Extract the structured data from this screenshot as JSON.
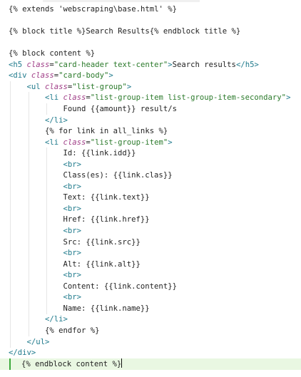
{
  "editor": {
    "lines": [
      {
        "indent": 0,
        "parts": [
          {
            "t": "plain",
            "v": "{% extends 'webscraping\\base.html' %}"
          }
        ]
      },
      {
        "indent": 0,
        "parts": []
      },
      {
        "indent": 0,
        "parts": [
          {
            "t": "plain",
            "v": "{% block title %}Search Results{% endblock title %}"
          }
        ]
      },
      {
        "indent": 0,
        "parts": []
      },
      {
        "indent": 0,
        "parts": [
          {
            "t": "plain",
            "v": "{% block content %}"
          }
        ]
      },
      {
        "indent": 0,
        "parts": [
          {
            "t": "tag",
            "v": "<h5 "
          },
          {
            "t": "attr",
            "v": "class"
          },
          {
            "t": "plain",
            "v": "="
          },
          {
            "t": "str",
            "v": "\"card-header text-center\""
          },
          {
            "t": "tag",
            "v": ">"
          },
          {
            "t": "plain",
            "v": "Search results"
          },
          {
            "t": "tag",
            "v": "</h5>"
          }
        ]
      },
      {
        "indent": 0,
        "parts": [
          {
            "t": "tag",
            "v": "<div "
          },
          {
            "t": "attr",
            "v": "class"
          },
          {
            "t": "plain",
            "v": "="
          },
          {
            "t": "str",
            "v": "\"card-body\""
          },
          {
            "t": "tag",
            "v": ">"
          }
        ]
      },
      {
        "indent": 1,
        "parts": [
          {
            "t": "tag",
            "v": "<ul "
          },
          {
            "t": "attr",
            "v": "class"
          },
          {
            "t": "plain",
            "v": "="
          },
          {
            "t": "str",
            "v": "\"list-group\""
          },
          {
            "t": "tag",
            "v": ">"
          }
        ]
      },
      {
        "indent": 2,
        "parts": [
          {
            "t": "tag",
            "v": "<li "
          },
          {
            "t": "attr",
            "v": "class"
          },
          {
            "t": "plain",
            "v": "="
          },
          {
            "t": "str",
            "v": "\"list-group-item list-group-item-secondary\""
          },
          {
            "t": "tag",
            "v": ">"
          }
        ]
      },
      {
        "indent": 3,
        "parts": [
          {
            "t": "plain",
            "v": "Found {{amount}} result/s"
          }
        ]
      },
      {
        "indent": 2,
        "parts": [
          {
            "t": "tag",
            "v": "</li>"
          }
        ]
      },
      {
        "indent": 2,
        "parts": [
          {
            "t": "plain",
            "v": "{% for link in all_links %}"
          }
        ]
      },
      {
        "indent": 2,
        "parts": [
          {
            "t": "tag",
            "v": "<li "
          },
          {
            "t": "attr",
            "v": "class"
          },
          {
            "t": "plain",
            "v": "="
          },
          {
            "t": "str",
            "v": "\"list-group-item\""
          },
          {
            "t": "tag",
            "v": ">"
          }
        ]
      },
      {
        "indent": 3,
        "parts": [
          {
            "t": "plain",
            "v": "Id: {{link.idd}}"
          }
        ]
      },
      {
        "indent": 3,
        "parts": [
          {
            "t": "tag",
            "v": "<br>"
          }
        ]
      },
      {
        "indent": 3,
        "parts": [
          {
            "t": "plain",
            "v": "Class(es): {{link.clas}}"
          }
        ]
      },
      {
        "indent": 3,
        "parts": [
          {
            "t": "tag",
            "v": "<br>"
          }
        ]
      },
      {
        "indent": 3,
        "parts": [
          {
            "t": "plain",
            "v": "Text: {{link.text}}"
          }
        ]
      },
      {
        "indent": 3,
        "parts": [
          {
            "t": "tag",
            "v": "<br>"
          }
        ]
      },
      {
        "indent": 3,
        "parts": [
          {
            "t": "plain",
            "v": "Href: {{link.href}}"
          }
        ]
      },
      {
        "indent": 3,
        "parts": [
          {
            "t": "tag",
            "v": "<br>"
          }
        ]
      },
      {
        "indent": 3,
        "parts": [
          {
            "t": "plain",
            "v": "Src: {{link.src}}"
          }
        ]
      },
      {
        "indent": 3,
        "parts": [
          {
            "t": "tag",
            "v": "<br>"
          }
        ]
      },
      {
        "indent": 3,
        "parts": [
          {
            "t": "plain",
            "v": "Alt: {{link.alt}}"
          }
        ]
      },
      {
        "indent": 3,
        "parts": [
          {
            "t": "tag",
            "v": "<br>"
          }
        ]
      },
      {
        "indent": 3,
        "parts": [
          {
            "t": "plain",
            "v": "Content: {{link.content}}"
          }
        ]
      },
      {
        "indent": 3,
        "parts": [
          {
            "t": "tag",
            "v": "<br>"
          }
        ]
      },
      {
        "indent": 3,
        "parts": [
          {
            "t": "plain",
            "v": "Name: {{link.name}}"
          }
        ]
      },
      {
        "indent": 2,
        "parts": [
          {
            "t": "tag",
            "v": "</li>"
          }
        ]
      },
      {
        "indent": 2,
        "parts": [
          {
            "t": "plain",
            "v": "{% endfor %}"
          }
        ]
      },
      {
        "indent": 1,
        "parts": [
          {
            "t": "tag",
            "v": "</ul>"
          }
        ]
      },
      {
        "indent": 0,
        "parts": [
          {
            "t": "tag",
            "v": "</div>"
          }
        ]
      },
      {
        "indent": 1,
        "highlight": true,
        "cursor": true,
        "parts": [
          {
            "t": "plain",
            "v": "{% endblock content %}"
          }
        ]
      }
    ]
  },
  "colors": {
    "tag": "#1f7a8c",
    "attribute": "#9f3c86",
    "string": "#2b7a2b",
    "text": "#222222",
    "current_line": "#e9f7e2"
  }
}
